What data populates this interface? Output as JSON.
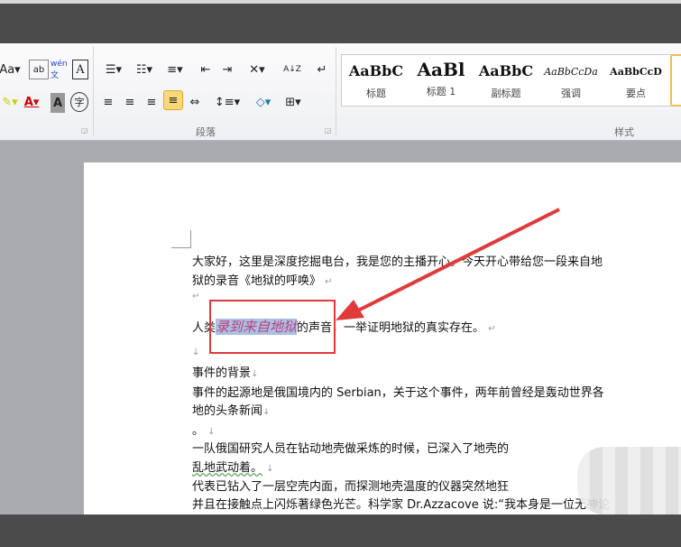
{
  "ribbon": {
    "font_row1": [
      "Aa▾",
      "ab",
      "wén 文",
      "A"
    ],
    "font_row2": [
      "✎▾",
      "A▾",
      "A",
      "字"
    ],
    "para_row1": [
      "☰▾",
      "☷▾",
      "≡▾",
      "⇤",
      "⇥",
      "✕▾",
      "A↓Z",
      "↵"
    ],
    "para_row2": [
      "≡",
      "≡",
      "≡",
      "≡",
      "⇔",
      "↕≡▾",
      "◇▾",
      "⊞▾"
    ],
    "paragraph_label": "段落",
    "styles_label": "样式",
    "styles": [
      {
        "sample": "AaBbC",
        "label": "标题"
      },
      {
        "sample": "AaBl",
        "label": "标题 1"
      },
      {
        "sample": "AaBbC",
        "label": "副标题"
      },
      {
        "sample": "AaBbCcDa",
        "label": "强调"
      },
      {
        "sample": "AaBbCcD",
        "label": "要点"
      }
    ]
  },
  "document": {
    "lines": [
      "大家好，这里是深度挖掘电台，我是您的主播开心。今天开心带给您一段来自地",
      "狱的录音《地狱的呼唤》",
      "",
      "",
      "",
      "事件的背景",
      "事件的起源地是俄国境内的  Serbian，关于这个事件，两年前曾经是轰动世界各",
      "地的头条新闻",
      "。",
      "一队俄国研究人员在钻动地壳做采炼的时候，已深入了地壳的",
      "乱地武动着。",
      "代表已钻入了一层空壳内面，而探测地壳温度的仪器突然地狂",
      "并且在接触点上闪烁著绿色光芒。科学家  Dr.Azzacove  说:“我本身是一位无神论"
    ],
    "highlight_line": {
      "before": "人类",
      "selected": "录到来自地狱",
      "after": "的声音，一举证明地狱的真实存在。"
    },
    "para_mark": "↵",
    "line_mark": "↓"
  },
  "colors": {
    "annotation": "#e03a3a",
    "selection": "#a9bfe3"
  }
}
